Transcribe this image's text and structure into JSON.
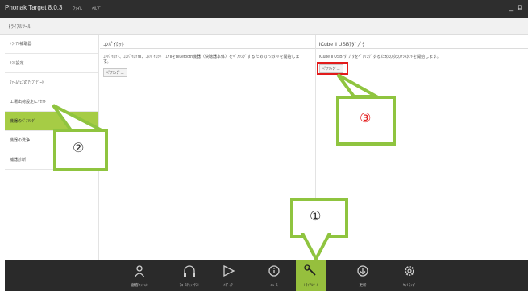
{
  "app": {
    "title": "Phonak Target 8.0.3",
    "menu": [
      "ﾌｧｲﾙ",
      "ﾍﾙﾌﾟ"
    ],
    "window_controls": "_ ⧉"
  },
  "subtitle": "ﾄﾗｲｱﾙﾂｰﾙ",
  "sidebar": {
    "items": [
      {
        "label": "ﾄﾗｲｱﾙ補聴器"
      },
      {
        "label": "ﾃｽﾄ設定"
      },
      {
        "label": "ﾌｧｰﾑｳｪｱのｱｯﾌﾟﾃﾞｰﾄ"
      },
      {
        "label": "工場出荷設定にﾘｾｯﾄ"
      },
      {
        "label": "機器のﾍﾟｱﾘﾝｸﾞ"
      },
      {
        "label": "機器の洗浄"
      },
      {
        "label": "補器診断"
      }
    ],
    "active_index": 4
  },
  "panel_left": {
    "heading": "ｺﾝﾊﾟｲﾛｯﾄ",
    "description": "ｺﾝﾊﾟｲﾛｯﾄ、ｺﾝﾊﾟｲﾛｯﾄⅡ、ｺﾝﾊﾟｲﾛｯﾄ　ｴｱⅡをBluetooth機器（快聴器本体）をﾍﾟｱﾘﾝｸﾞするためのｱｼｽﾀﾝﾄを開始します。",
    "button": "ﾍﾟｱﾘﾝｸﾞ..."
  },
  "panel_right": {
    "heading": "iCube Ⅱ USBｱﾀﾞﾌﾟﾀ",
    "description": "iCube Ⅱ USBｱﾀﾞﾌﾟﾀをﾍﾟｱﾘﾝｸﾞするための次のｱｼｽﾀﾝﾄを開始します。",
    "button": "ﾍﾟｱﾘﾝｸﾞ..."
  },
  "callouts": {
    "one": "①",
    "two": "②",
    "three": "③"
  },
  "bottom_nav": {
    "items": [
      {
        "label": "顧客ｾｯｼｮﾝ",
        "icon": "person-icon"
      },
      {
        "label": "ｱｺｰｽﾃｨｯｸﾃｽﾄ",
        "icon": "headphones-icon"
      },
      {
        "label": "ﾒﾃﾞｨｱ",
        "icon": "play-icon"
      },
      {
        "label": "ﾆｭｰｽ",
        "icon": "info-icon"
      },
      {
        "label": "ﾄﾗｲｱﾙﾂｰﾙ",
        "icon": "wrench-icon"
      },
      {
        "label": "更新",
        "icon": "download-icon"
      },
      {
        "label": "ｾｯﾄｱｯﾌﾟ",
        "icon": "gear-icon"
      }
    ],
    "active_index": 4
  },
  "colors": {
    "accent": "#a6cc45",
    "callout": "#8fc43f",
    "highlight": "#e21b1b",
    "bar": "#2a2a2a"
  }
}
